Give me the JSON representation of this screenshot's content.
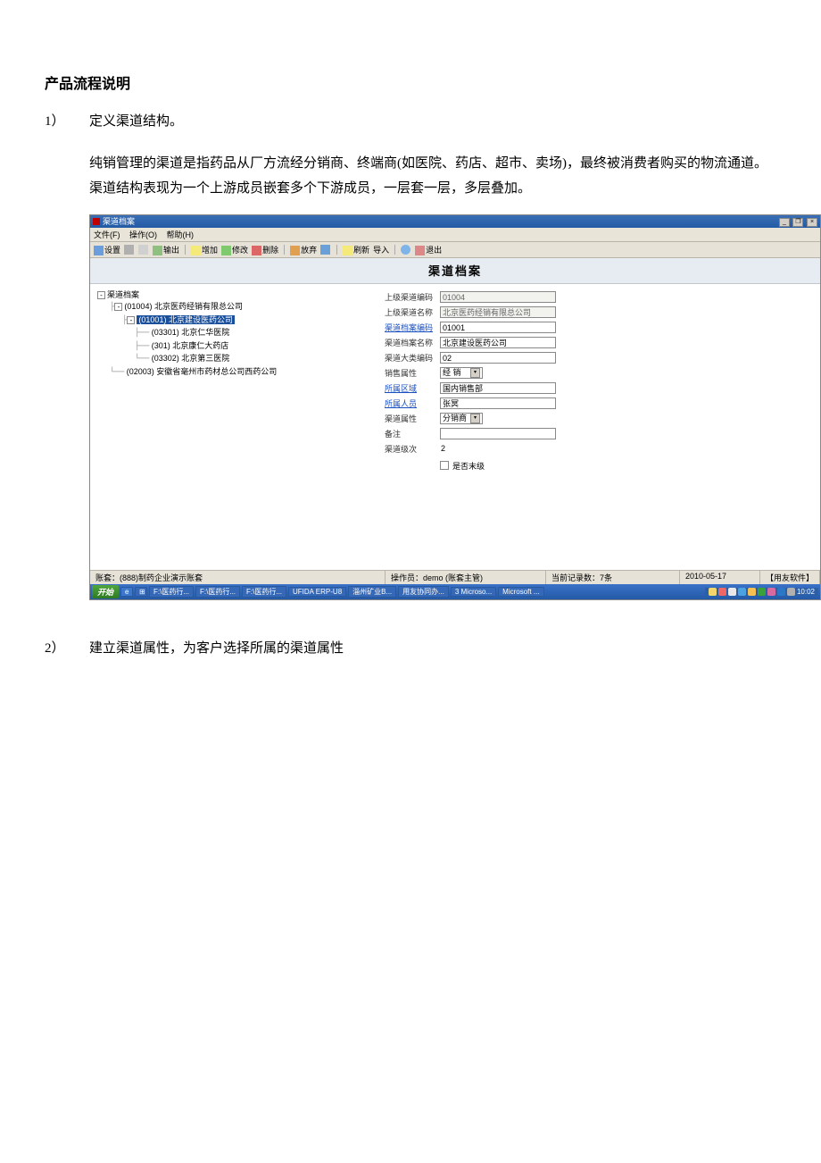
{
  "doc": {
    "heading": "产品流程说明",
    "step1_num": "1）",
    "step1_title": "定义渠道结构。",
    "step1_body": "纯销管理的渠道是指药品从厂方流经分销商、终端商(如医院、药店、超市、卖场)，最终被消费者购买的物流通道。渠道结构表现为一个上游成员嵌套多个下游成员，一层套一层，多层叠加。",
    "step2_num": "2）",
    "step2_title": "建立渠道属性，为客户选择所属的渠道属性"
  },
  "app": {
    "title": "渠道档案",
    "menu": {
      "file": "文件(F)",
      "op": "操作(O)",
      "help": "帮助(H)"
    },
    "toolbar": {
      "set": "设置",
      "out": "输出",
      "add": "增加",
      "mod": "修改",
      "del": "删除",
      "undo": "放弃",
      "expand": "展开",
      "refresh": "刷新",
      "import": "导入",
      "exit": "退出"
    },
    "doc_title": "渠道档案",
    "tree": {
      "root": "渠道档案",
      "n1": "(01004) 北京医药经销有限总公司",
      "n2": "(01001) 北京建设医药公司",
      "n3": "(03301) 北京仁华医院",
      "n4": "(301) 北京康仁大药店",
      "n5": "(03302) 北京第三医院",
      "n6": "(02003) 安徽省毫州市药材总公司西药公司"
    },
    "form": {
      "l_upper_code": "上级渠道编码",
      "v_upper_code": "01004",
      "l_upper_name": "上级渠道名称",
      "v_upper_name": "北京医药经销有限总公司",
      "l_code": "渠道档案编码",
      "v_code": "01001",
      "l_name": "渠道档案名称",
      "v_name": "北京建设医药公司",
      "l_bigcls": "渠道大类编码",
      "v_bigcls": "02",
      "l_sales": "销售属性",
      "v_sales": "经  销",
      "l_region": "所属区域",
      "v_region": "国内销售部",
      "l_person": "所属人员",
      "v_person": "张冥",
      "l_chan": "渠道属性",
      "v_chan": "分销商",
      "l_remark": "备注",
      "v_remark": "",
      "l_level": "渠道级次",
      "v_level": "2",
      "l_isend": "是否末级"
    },
    "status": {
      "acct": "账套：(888)制药企业演示账套",
      "oper": "操作员：demo (账套主管)",
      "count": "当前记录数：7条",
      "date": "2010-05-17",
      "brand": "【用友软件】"
    },
    "taskbar": {
      "start": "开始",
      "t1": "F:\\医药行...",
      "t2": "F:\\医药行...",
      "t3": "F:\\医药行...",
      "t4": "UFIDA ERP-U8",
      "t5": "淄州矿业B...",
      "t6": "用友协同办...",
      "t7": "3 Microso...",
      "t8": "Microsoft ...",
      "time": "10:02"
    }
  }
}
